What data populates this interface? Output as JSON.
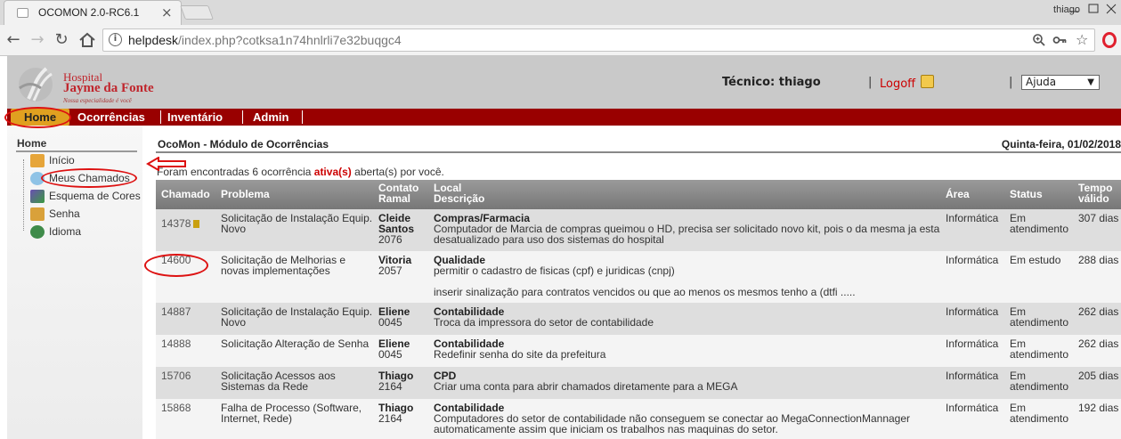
{
  "browser": {
    "tab_title": "OCOMON 2.0-RC6.1",
    "tab_close": "×",
    "profile_name": "thiago",
    "url_host": "helpdesk",
    "url_path": "/index.php?cotksa1n74hnlrli7e32buqgc4"
  },
  "header": {
    "logo_line1": "Hospital",
    "logo_line2": "Jayme da Fonte",
    "logo_tagline": "Nossa especialidade é você",
    "tecnico_label": "Técnico: thiago",
    "separator": "|",
    "logoff_label": "Logoff",
    "help_select_value": "Ajuda"
  },
  "menu": {
    "items": [
      "Home",
      "Ocorrências",
      "Inventário",
      "Admin"
    ]
  },
  "sidebar": {
    "title": "Home",
    "items": [
      {
        "label": "Início",
        "icon": "home-icon"
      },
      {
        "label": "Meus Chamados",
        "icon": "search-icon"
      },
      {
        "label": "Esquema de Cores",
        "icon": "palette-icon"
      },
      {
        "label": "Senha",
        "icon": "key-icon"
      },
      {
        "label": "Idioma",
        "icon": "globe-icon"
      }
    ]
  },
  "main": {
    "title": "OcoMon - Módulo de Ocorrências",
    "date": "Quinta-feira, 01/02/2018",
    "found_prefix": "Foram encontradas 6 ocorrência",
    "found_highlight": "ativa(s)",
    "found_suffix": "aberta(s) por você."
  },
  "table": {
    "headers": {
      "chamado": "Chamado",
      "problema": "Problema",
      "contato": "Contato",
      "ramal": "Ramal",
      "local": "Local",
      "descricao": "Descrição",
      "area": "Área",
      "status": "Status",
      "tempo": "Tempo",
      "valido": "válido"
    },
    "rows": [
      {
        "num": "14378",
        "flag": true,
        "problema": "Solicitação de Instalação Equip. Novo",
        "contato": "Cleide Santos",
        "ramal": "2076",
        "local": "Compras/Farmacia",
        "descricao": " Computador de Marcia de compras queimou o HD, precisa ser solicitado novo kit, pois o da mesma ja esta desatualizado para uso dos sistemas do hospital",
        "descricao2": "",
        "area": "Informática",
        "status": "Em atendimento",
        "tempo": "307 dias"
      },
      {
        "num": "14600",
        "flag": false,
        "problema": "Solicitação de Melhorias e novas implementações",
        "contato": "Vitoria",
        "ramal": "2057",
        "local": "Qualidade",
        "descricao": " permitir o cadastro de fisicas (cpf) e juridicas (cnpj)",
        "descricao2": "inserir sinalização para contratos vencidos ou que ao menos os mesmos tenho a (dtfi .....",
        "area": "Informática",
        "status": "Em estudo",
        "tempo": "288 dias"
      },
      {
        "num": "14887",
        "flag": false,
        "problema": "Solicitação de Instalação Equip. Novo",
        "contato": "Eliene",
        "ramal": "0045",
        "local": "Contabilidade",
        "descricao": " Troca da impressora do setor de contabilidade",
        "descricao2": "",
        "area": "Informática",
        "status": "Em atendimento",
        "tempo": "262 dias"
      },
      {
        "num": "14888",
        "flag": false,
        "problema": "Solicitação Alteração de Senha",
        "contato": "Eliene",
        "ramal": "0045",
        "local": "Contabilidade",
        "descricao": " Redefinir senha do site da prefeitura",
        "descricao2": "",
        "area": "Informática",
        "status": "Em atendimento",
        "tempo": "262 dias"
      },
      {
        "num": "15706",
        "flag": false,
        "problema": "Solicitação Acessos aos Sistemas da Rede",
        "contato": "Thiago",
        "ramal": "2164",
        "local": "CPD",
        "descricao": "Criar uma conta para abrir chamados diretamente para a MEGA",
        "descricao2": "",
        "area": "Informática",
        "status": "Em atendimento",
        "tempo": "205 dias"
      },
      {
        "num": "15868",
        "flag": false,
        "problema": "Falha de Processo (Software, Internet, Rede)",
        "contato": "Thiago",
        "ramal": "2164",
        "local": "Contabilidade",
        "descricao": " Computadores do setor de contabilidade não conseguem se conectar ao MegaConnectionMannager automaticamente assim que iniciam os trabalhos nas maquinas do setor.",
        "descricao2": "",
        "area": "Informática",
        "status": "Em atendimento",
        "tempo": "192 dias"
      }
    ]
  },
  "colors": {
    "menu_bar": "#990000",
    "home_active": "#e0a020",
    "highlight_red": "#cc0000",
    "annotation_red": "#dd1111"
  }
}
